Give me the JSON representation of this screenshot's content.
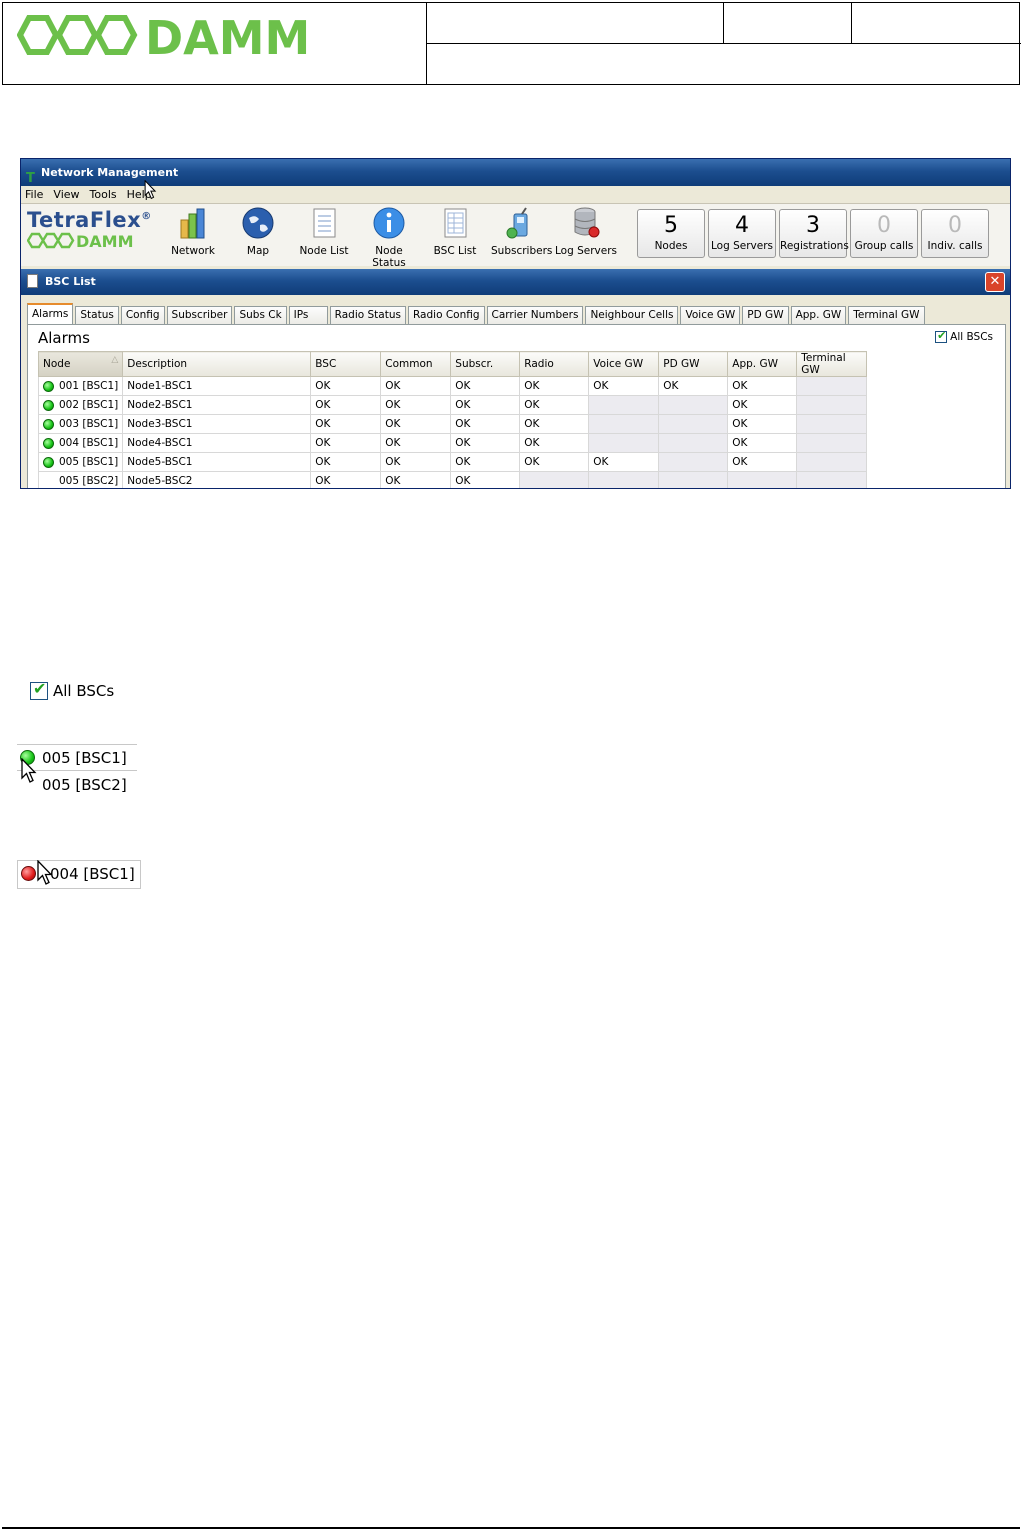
{
  "document": {
    "logo_text": "DAMM"
  },
  "app": {
    "title": "Network Management",
    "menu": [
      "File",
      "View",
      "Tools",
      "Help"
    ],
    "brand": {
      "name": "TetraFlex",
      "mark": "®",
      "sub": "DAMM"
    },
    "tools": [
      "Network",
      "Map",
      "Node List",
      "Node Status",
      "BSC List",
      "Subscribers",
      "Log Servers"
    ],
    "counters": [
      {
        "value": "5",
        "label": "Nodes",
        "dimmed": false
      },
      {
        "value": "4",
        "label": "Log Servers",
        "dimmed": false
      },
      {
        "value": "3",
        "label": "Registrations",
        "dimmed": false
      },
      {
        "value": "0",
        "label": "Group calls",
        "dimmed": true
      },
      {
        "value": "0",
        "label": "Indiv. calls",
        "dimmed": true
      }
    ]
  },
  "bsc_window": {
    "title": "BSC List",
    "tabs": [
      "Alarms",
      "Status",
      "Config",
      "Subscriber",
      "Subs Ck",
      "IPs",
      "Radio Status",
      "Radio Config",
      "Carrier Numbers",
      "Neighbour Cells",
      "Voice GW",
      "PD GW",
      "App. GW",
      "Terminal GW"
    ],
    "active_tab": "Alarms",
    "panel_title": "Alarms",
    "all_bscs_label": "All BSCs",
    "all_bscs_checked": true,
    "columns": [
      "Node",
      "Description",
      "BSC",
      "Common",
      "Subscr.",
      "Radio",
      "Voice GW",
      "PD GW",
      "App. GW",
      "Terminal GW"
    ],
    "rows": [
      {
        "status": "green",
        "cells": [
          "001 [BSC1]",
          "Node1-BSC1",
          "OK",
          "OK",
          "OK",
          "OK",
          "OK",
          "OK",
          "OK",
          ""
        ]
      },
      {
        "status": "green",
        "cells": [
          "002 [BSC1]",
          "Node2-BSC1",
          "OK",
          "OK",
          "OK",
          "OK",
          "",
          "",
          "OK",
          ""
        ]
      },
      {
        "status": "green",
        "cells": [
          "003 [BSC1]",
          "Node3-BSC1",
          "OK",
          "OK",
          "OK",
          "OK",
          "",
          "",
          "OK",
          ""
        ]
      },
      {
        "status": "green",
        "cells": [
          "004 [BSC1]",
          "Node4-BSC1",
          "OK",
          "OK",
          "OK",
          "OK",
          "",
          "",
          "OK",
          ""
        ]
      },
      {
        "status": "green",
        "cells": [
          "005 [BSC1]",
          "Node5-BSC1",
          "OK",
          "OK",
          "OK",
          "OK",
          "OK",
          "",
          "OK",
          ""
        ]
      },
      {
        "status": "none",
        "cells": [
          "005 [BSC2]",
          "Node5-BSC2",
          "OK",
          "OK",
          "OK",
          "",
          "",
          "",
          "",
          ""
        ]
      }
    ]
  },
  "snippets": {
    "all_bscs_label": "All BSCs",
    "node_rows": [
      "005 [BSC1]",
      "005 [BSC2]"
    ],
    "red_node": "004 [BSC1]"
  },
  "colors": {
    "title_bar": "#1c4e8f",
    "status_ok": "#16c316",
    "status_alarm": "#e01a1a",
    "damm_green": "#6cc04a"
  }
}
